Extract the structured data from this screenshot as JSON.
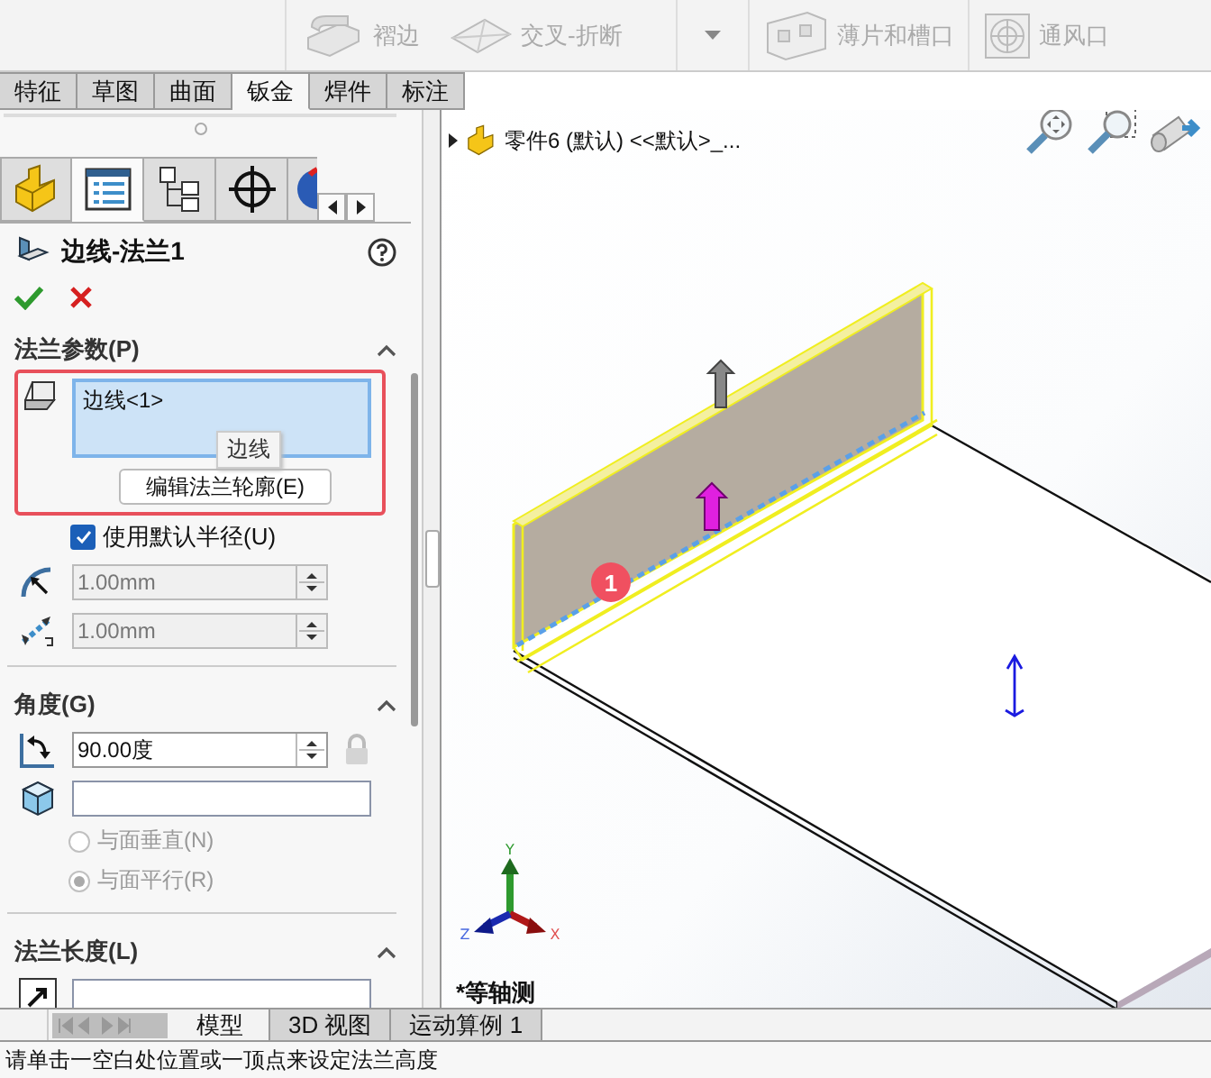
{
  "toolbar": {
    "buttons": [
      {
        "kind": "hem",
        "label": "褶边",
        "disabled": true
      },
      {
        "kind": "cross-break",
        "label": "交叉-折断",
        "disabled": true
      },
      {
        "kind": "more",
        "disabled": true
      },
      {
        "kind": "tab-slot",
        "label": "薄片和槽口",
        "disabled": true
      },
      {
        "kind": "vent",
        "label": "通风口",
        "disabled": true
      }
    ]
  },
  "tabs": [
    {
      "label": "特征",
      "selected": false
    },
    {
      "label": "草图",
      "selected": false
    },
    {
      "label": "曲面",
      "selected": false
    },
    {
      "label": "钣金",
      "selected": true
    },
    {
      "label": "焊件",
      "selected": false
    },
    {
      "label": "标注",
      "selected": false
    }
  ],
  "panel_tabs": [
    {
      "kind": "part",
      "selected": false
    },
    {
      "kind": "property",
      "selected": true
    },
    {
      "kind": "config",
      "selected": false
    },
    {
      "kind": "crosshair",
      "selected": false
    },
    {
      "kind": "display",
      "selected": false
    }
  ],
  "feature": {
    "title": "边线-法兰1"
  },
  "flange_params": {
    "title": "法兰参数(P)",
    "expanded": true,
    "edge_list": "边线<1>",
    "tooltip": "边线",
    "edit_button": "编辑法兰轮廓(E)",
    "use_default_radius": {
      "label": "使用默认半径(U)",
      "checked": true
    },
    "bend_radius": {
      "value": "1.00mm",
      "disabled": true
    },
    "gap": {
      "value": "1.00mm",
      "disabled": true
    }
  },
  "angle": {
    "title": "角度(G)",
    "expanded": true,
    "value": "90.00度",
    "options": [
      {
        "label": "与面垂直(N)",
        "selected": false,
        "disabled": true
      },
      {
        "label": "与面平行(R)",
        "selected": true,
        "disabled": true
      }
    ]
  },
  "flange_length": {
    "title": "法兰长度(L)",
    "expanded": true
  },
  "viewport": {
    "tree_item": "零件6 (默认) <<默认>_...",
    "badge": "1",
    "axes": {
      "x": "X",
      "y": "Y",
      "z": "Z"
    },
    "view_label": "*等轴测"
  },
  "bottom_tabs": [
    {
      "label": "模型",
      "selected": true
    },
    {
      "label": "3D 视图",
      "selected": false
    },
    {
      "label": "运动算例 1",
      "selected": false
    }
  ],
  "status_bar": "请单击一空白处位置或一顶点来设定法兰高度"
}
